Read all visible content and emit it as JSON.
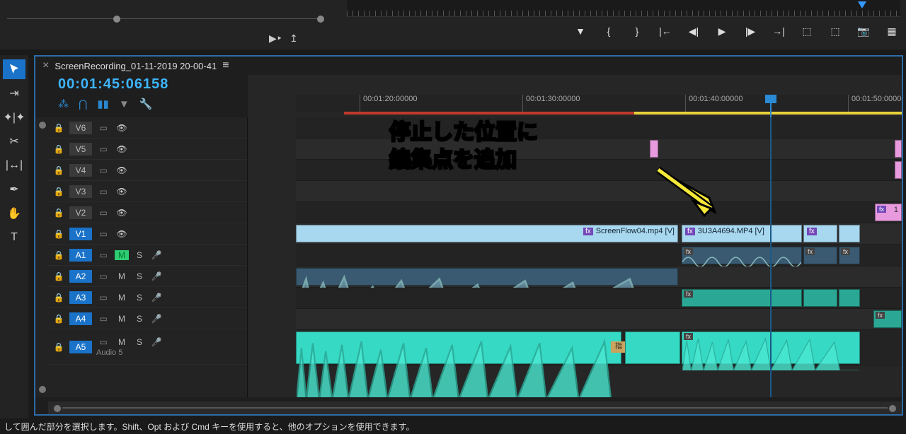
{
  "sequence": {
    "name": "ScreenRecording_01-11-2019 20-00-41",
    "timecode": "00:01:45:06158"
  },
  "ruler": {
    "ticks": [
      "00:01:20:00000",
      "00:01:30:00000",
      "00:01:40:00000",
      "00:01:50:00000"
    ]
  },
  "annotation": {
    "line1": "停止した位置に",
    "line2": "編集点を追加"
  },
  "tracks": {
    "video": [
      {
        "id": "V6",
        "target": false
      },
      {
        "id": "V5",
        "target": false
      },
      {
        "id": "V4",
        "target": false
      },
      {
        "id": "V3",
        "target": false
      },
      {
        "id": "V2",
        "target": false
      },
      {
        "id": "V1",
        "target": true
      }
    ],
    "audio": [
      {
        "id": "A1",
        "target": true,
        "mute": true,
        "label": ""
      },
      {
        "id": "A2",
        "target": true,
        "mute": false,
        "label": ""
      },
      {
        "id": "A3",
        "target": true,
        "mute": false,
        "label": ""
      },
      {
        "id": "A4",
        "target": true,
        "mute": false,
        "label": ""
      },
      {
        "id": "A5",
        "target": true,
        "mute": false,
        "label": "Audio 5"
      }
    ]
  },
  "clips": {
    "v1_a": {
      "name": "ScreenFlow04.mp4 [V]",
      "fx": "fx"
    },
    "v1_b": {
      "name": "3U3A4694.MP4 [V]",
      "fx": "fx"
    },
    "fx_label": "fx",
    "v2_num": "1",
    "marker": "指"
  },
  "status": "して囲んだ部分を選択します。Shift、Opt および Cmd キーを使用すると、他のオプションを使用できます。",
  "btns": {
    "M": "M",
    "S": "S"
  }
}
